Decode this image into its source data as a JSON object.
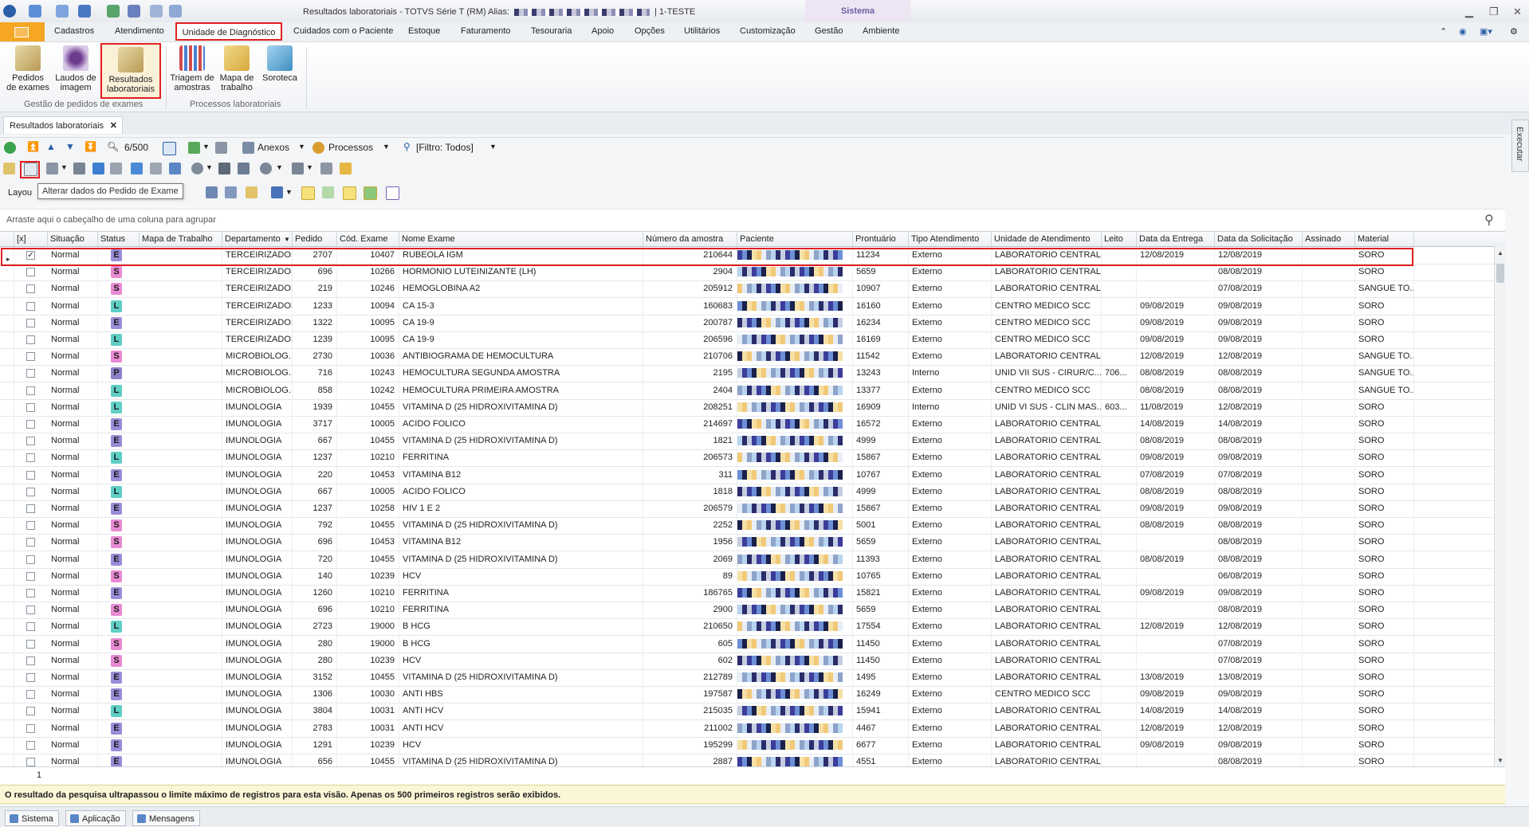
{
  "window": {
    "title": "Resultados laboratoriais - TOTVS Série T  (RM) Alias:",
    "title_suffix": "| 1-TESTE",
    "context_tab": "Sistema"
  },
  "ribbon_tabs": [
    "Cadastros",
    "Atendimento",
    "Unidade de Diagnóstico",
    "Cuidados com o Paciente",
    "Estoque",
    "Faturamento",
    "Tesouraria",
    "Apoio",
    "Opções",
    "Utilitários",
    "Customização",
    "Gestão",
    "Ambiente"
  ],
  "ribbon": {
    "groups": [
      {
        "name": "Gestão de pedidos de exames",
        "buttons": [
          {
            "line1": "Pedidos",
            "line2": "de exames",
            "icon": "pedidos-icon"
          },
          {
            "line1": "Laudos de",
            "line2": "imagem",
            "icon": "laudos-icon"
          },
          {
            "line1": "Resultados",
            "line2": "laboratoriais",
            "icon": "resultados-icon"
          }
        ]
      },
      {
        "name": "Processos laboratoriais",
        "buttons": [
          {
            "line1": "Triagem de",
            "line2": "amostras",
            "icon": "triagem-icon"
          },
          {
            "line1": "Mapa de",
            "line2": "trabalho",
            "icon": "mapa-icon"
          },
          {
            "line1": "Soroteca",
            "line2": "",
            "icon": "soroteca-icon"
          }
        ]
      }
    ]
  },
  "doc_tab": {
    "label": "Resultados laboratoriais",
    "close": "✕"
  },
  "toolbar": {
    "record_counter": "6/500",
    "anexos": "Anexos",
    "processos": "Processos",
    "filtro": "[Filtro: Todos]",
    "layout": "Layou",
    "side_panel": "Executar"
  },
  "tooltip": "Alterar dados do Pedido de Exame",
  "group_hint": "Arraste aqui o cabeçalho de uma coluna para agrupar",
  "columns": [
    "[x]",
    "Situação",
    "Status",
    "Mapa de Trabalho",
    "Departamento",
    "Pedido",
    "Cód. Exame",
    "Nome Exame",
    "Número da amostra",
    "Paciente",
    "Prontuário",
    "Tipo Atendimento",
    "Unidade de Atendimento",
    "Leito",
    "Data da Entrega",
    "Data da Solicitação",
    "Assinado",
    "Material"
  ],
  "status_colors": {
    "E": "#9b8cd9",
    "S": "#e88ad3",
    "L": "#5fcfc6",
    "P": "#8d82c9"
  },
  "rows": [
    {
      "chk": "✓",
      "sit": "Normal",
      "st": "E",
      "dep": "TERCEIRIZADOS",
      "ped": "2707",
      "cod": "10407",
      "nome": "RUBEOLA IGM",
      "amostra": "210644",
      "pront": "11234",
      "tipo": "Externo",
      "unid": "LABORATORIO CENTRAL",
      "leito": "",
      "entrega": "12/08/2019",
      "solic": "12/08/2019",
      "mat": "SORO"
    },
    {
      "chk": "",
      "sit": "Normal",
      "st": "S",
      "dep": "TERCEIRIZADOS",
      "ped": "696",
      "cod": "10266",
      "nome": "HORMONIO LUTEINIZANTE (LH)",
      "amostra": "2904",
      "pront": "5659",
      "tipo": "Externo",
      "unid": "LABORATORIO CENTRAL",
      "leito": "",
      "entrega": "",
      "solic": "08/08/2019",
      "mat": "SORO"
    },
    {
      "chk": "",
      "sit": "Normal",
      "st": "S",
      "dep": "TERCEIRIZADOS",
      "ped": "219",
      "cod": "10246",
      "nome": "HEMOGLOBINA A2",
      "amostra": "205912",
      "pront": "10907",
      "tipo": "Externo",
      "unid": "LABORATORIO CENTRAL",
      "leito": "",
      "entrega": "",
      "solic": "07/08/2019",
      "mat": "SANGUE TO..."
    },
    {
      "chk": "",
      "sit": "Normal",
      "st": "L",
      "dep": "TERCEIRIZADOS",
      "ped": "1233",
      "cod": "10094",
      "nome": "CA 15-3",
      "amostra": "160683",
      "pront": "16160",
      "tipo": "Externo",
      "unid": "CENTRO MEDICO SCC",
      "leito": "",
      "entrega": "09/08/2019",
      "solic": "09/08/2019",
      "mat": "SORO"
    },
    {
      "chk": "",
      "sit": "Normal",
      "st": "E",
      "dep": "TERCEIRIZADOS",
      "ped": "1322",
      "cod": "10095",
      "nome": "CA 19-9",
      "amostra": "200787",
      "pront": "16234",
      "tipo": "Externo",
      "unid": "CENTRO MEDICO SCC",
      "leito": "",
      "entrega": "09/08/2019",
      "solic": "09/08/2019",
      "mat": "SORO"
    },
    {
      "chk": "",
      "sit": "Normal",
      "st": "L",
      "dep": "TERCEIRIZADOS",
      "ped": "1239",
      "cod": "10095",
      "nome": "CA 19-9",
      "amostra": "206596",
      "pront": "16169",
      "tipo": "Externo",
      "unid": "CENTRO MEDICO SCC",
      "leito": "",
      "entrega": "09/08/2019",
      "solic": "09/08/2019",
      "mat": "SORO"
    },
    {
      "chk": "",
      "sit": "Normal",
      "st": "S",
      "dep": "MICROBIOLOG...",
      "ped": "2730",
      "cod": "10036",
      "nome": "ANTIBIOGRAMA DE HEMOCULTURA",
      "amostra": "210706",
      "pront": "11542",
      "tipo": "Externo",
      "unid": "LABORATORIO CENTRAL",
      "leito": "",
      "entrega": "12/08/2019",
      "solic": "12/08/2019",
      "mat": "SANGUE TO..."
    },
    {
      "chk": "",
      "sit": "Normal",
      "st": "P",
      "dep": "MICROBIOLOG...",
      "ped": "716",
      "cod": "10243",
      "nome": "HEMOCULTURA SEGUNDA AMOSTRA",
      "amostra": "2195",
      "pront": "13243",
      "tipo": "Interno",
      "unid": "UNID VII SUS - CIRUR/C...",
      "leito": "706...",
      "entrega": "08/08/2019",
      "solic": "08/08/2019",
      "mat": "SANGUE TO..."
    },
    {
      "chk": "",
      "sit": "Normal",
      "st": "L",
      "dep": "MICROBIOLOG...",
      "ped": "858",
      "cod": "10242",
      "nome": "HEMOCULTURA PRIMEIRA AMOSTRA",
      "amostra": "2404",
      "pront": "13377",
      "tipo": "Externo",
      "unid": "CENTRO MEDICO SCC",
      "leito": "",
      "entrega": "08/08/2019",
      "solic": "08/08/2019",
      "mat": "SANGUE TO..."
    },
    {
      "chk": "",
      "sit": "Normal",
      "st": "L",
      "dep": "IMUNOLOGIA",
      "ped": "1939",
      "cod": "10455",
      "nome": "VITAMINA D (25 HIDROXIVITAMINA D)",
      "amostra": "208251",
      "pront": "16909",
      "tipo": "Interno",
      "unid": "UNID VI SUS - CLIN MAS...",
      "leito": "603...",
      "entrega": "11/08/2019",
      "solic": "12/08/2019",
      "mat": "SORO"
    },
    {
      "chk": "",
      "sit": "Normal",
      "st": "E",
      "dep": "IMUNOLOGIA",
      "ped": "3717",
      "cod": "10005",
      "nome": "ACIDO FOLICO",
      "amostra": "214697",
      "pront": "16572",
      "tipo": "Externo",
      "unid": "LABORATORIO CENTRAL",
      "leito": "",
      "entrega": "14/08/2019",
      "solic": "14/08/2019",
      "mat": "SORO"
    },
    {
      "chk": "",
      "sit": "Normal",
      "st": "E",
      "dep": "IMUNOLOGIA",
      "ped": "667",
      "cod": "10455",
      "nome": "VITAMINA D (25 HIDROXIVITAMINA D)",
      "amostra": "1821",
      "pront": "4999",
      "tipo": "Externo",
      "unid": "LABORATORIO CENTRAL",
      "leito": "",
      "entrega": "08/08/2019",
      "solic": "08/08/2019",
      "mat": "SORO"
    },
    {
      "chk": "",
      "sit": "Normal",
      "st": "L",
      "dep": "IMUNOLOGIA",
      "ped": "1237",
      "cod": "10210",
      "nome": "FERRITINA",
      "amostra": "206573",
      "pront": "15867",
      "tipo": "Externo",
      "unid": "LABORATORIO CENTRAL",
      "leito": "",
      "entrega": "09/08/2019",
      "solic": "09/08/2019",
      "mat": "SORO"
    },
    {
      "chk": "",
      "sit": "Normal",
      "st": "E",
      "dep": "IMUNOLOGIA",
      "ped": "220",
      "cod": "10453",
      "nome": "VITAMINA B12",
      "amostra": "311",
      "pront": "10767",
      "tipo": "Externo",
      "unid": "LABORATORIO CENTRAL",
      "leito": "",
      "entrega": "07/08/2019",
      "solic": "07/08/2019",
      "mat": "SORO"
    },
    {
      "chk": "",
      "sit": "Normal",
      "st": "L",
      "dep": "IMUNOLOGIA",
      "ped": "667",
      "cod": "10005",
      "nome": "ACIDO FOLICO",
      "amostra": "1818",
      "pront": "4999",
      "tipo": "Externo",
      "unid": "LABORATORIO CENTRAL",
      "leito": "",
      "entrega": "08/08/2019",
      "solic": "08/08/2019",
      "mat": "SORO"
    },
    {
      "chk": "",
      "sit": "Normal",
      "st": "E",
      "dep": "IMUNOLOGIA",
      "ped": "1237",
      "cod": "10258",
      "nome": "HIV 1 E 2",
      "amostra": "206579",
      "pront": "15867",
      "tipo": "Externo",
      "unid": "LABORATORIO CENTRAL",
      "leito": "",
      "entrega": "09/08/2019",
      "solic": "09/08/2019",
      "mat": "SORO"
    },
    {
      "chk": "",
      "sit": "Normal",
      "st": "S",
      "dep": "IMUNOLOGIA",
      "ped": "792",
      "cod": "10455",
      "nome": "VITAMINA D (25 HIDROXIVITAMINA D)",
      "amostra": "2252",
      "pront": "5001",
      "tipo": "Externo",
      "unid": "LABORATORIO CENTRAL",
      "leito": "",
      "entrega": "08/08/2019",
      "solic": "08/08/2019",
      "mat": "SORO"
    },
    {
      "chk": "",
      "sit": "Normal",
      "st": "S",
      "dep": "IMUNOLOGIA",
      "ped": "696",
      "cod": "10453",
      "nome": "VITAMINA B12",
      "amostra": "1956",
      "pront": "5659",
      "tipo": "Externo",
      "unid": "LABORATORIO CENTRAL",
      "leito": "",
      "entrega": "",
      "solic": "08/08/2019",
      "mat": "SORO"
    },
    {
      "chk": "",
      "sit": "Normal",
      "st": "E",
      "dep": "IMUNOLOGIA",
      "ped": "720",
      "cod": "10455",
      "nome": "VITAMINA D (25 HIDROXIVITAMINA D)",
      "amostra": "2069",
      "pront": "11393",
      "tipo": "Externo",
      "unid": "LABORATORIO CENTRAL",
      "leito": "",
      "entrega": "08/08/2019",
      "solic": "08/08/2019",
      "mat": "SORO"
    },
    {
      "chk": "",
      "sit": "Normal",
      "st": "S",
      "dep": "IMUNOLOGIA",
      "ped": "140",
      "cod": "10239",
      "nome": "HCV",
      "amostra": "89",
      "pront": "10765",
      "tipo": "Externo",
      "unid": "LABORATORIO CENTRAL",
      "leito": "",
      "entrega": "",
      "solic": "06/08/2019",
      "mat": "SORO"
    },
    {
      "chk": "",
      "sit": "Normal",
      "st": "E",
      "dep": "IMUNOLOGIA",
      "ped": "1260",
      "cod": "10210",
      "nome": "FERRITINA",
      "amostra": "186765",
      "pront": "15821",
      "tipo": "Externo",
      "unid": "LABORATORIO CENTRAL",
      "leito": "",
      "entrega": "09/08/2019",
      "solic": "09/08/2019",
      "mat": "SORO"
    },
    {
      "chk": "",
      "sit": "Normal",
      "st": "S",
      "dep": "IMUNOLOGIA",
      "ped": "696",
      "cod": "10210",
      "nome": "FERRITINA",
      "amostra": "2900",
      "pront": "5659",
      "tipo": "Externo",
      "unid": "LABORATORIO CENTRAL",
      "leito": "",
      "entrega": "",
      "solic": "08/08/2019",
      "mat": "SORO"
    },
    {
      "chk": "",
      "sit": "Normal",
      "st": "L",
      "dep": "IMUNOLOGIA",
      "ped": "2723",
      "cod": "19000",
      "nome": "B HCG",
      "amostra": "210650",
      "pront": "17554",
      "tipo": "Externo",
      "unid": "LABORATORIO CENTRAL",
      "leito": "",
      "entrega": "12/08/2019",
      "solic": "12/08/2019",
      "mat": "SORO"
    },
    {
      "chk": "",
      "sit": "Normal",
      "st": "S",
      "dep": "IMUNOLOGIA",
      "ped": "280",
      "cod": "19000",
      "nome": "B HCG",
      "amostra": "605",
      "pront": "11450",
      "tipo": "Externo",
      "unid": "LABORATORIO CENTRAL",
      "leito": "",
      "entrega": "",
      "solic": "07/08/2019",
      "mat": "SORO"
    },
    {
      "chk": "",
      "sit": "Normal",
      "st": "S",
      "dep": "IMUNOLOGIA",
      "ped": "280",
      "cod": "10239",
      "nome": "HCV",
      "amostra": "602",
      "pront": "11450",
      "tipo": "Externo",
      "unid": "LABORATORIO CENTRAL",
      "leito": "",
      "entrega": "",
      "solic": "07/08/2019",
      "mat": "SORO"
    },
    {
      "chk": "",
      "sit": "Normal",
      "st": "E",
      "dep": "IMUNOLOGIA",
      "ped": "3152",
      "cod": "10455",
      "nome": "VITAMINA D (25 HIDROXIVITAMINA D)",
      "amostra": "212789",
      "pront": "1495",
      "tipo": "Externo",
      "unid": "LABORATORIO CENTRAL",
      "leito": "",
      "entrega": "13/08/2019",
      "solic": "13/08/2019",
      "mat": "SORO"
    },
    {
      "chk": "",
      "sit": "Normal",
      "st": "E",
      "dep": "IMUNOLOGIA",
      "ped": "1306",
      "cod": "10030",
      "nome": "ANTI HBS",
      "amostra": "197587",
      "pront": "16249",
      "tipo": "Externo",
      "unid": "CENTRO MEDICO SCC",
      "leito": "",
      "entrega": "09/08/2019",
      "solic": "09/08/2019",
      "mat": "SORO"
    },
    {
      "chk": "",
      "sit": "Normal",
      "st": "L",
      "dep": "IMUNOLOGIA",
      "ped": "3804",
      "cod": "10031",
      "nome": "ANTI HCV",
      "amostra": "215035",
      "pront": "15941",
      "tipo": "Externo",
      "unid": "LABORATORIO CENTRAL",
      "leito": "",
      "entrega": "14/08/2019",
      "solic": "14/08/2019",
      "mat": "SORO"
    },
    {
      "chk": "",
      "sit": "Normal",
      "st": "E",
      "dep": "IMUNOLOGIA",
      "ped": "2783",
      "cod": "10031",
      "nome": "ANTI HCV",
      "amostra": "211002",
      "pront": "4467",
      "tipo": "Externo",
      "unid": "LABORATORIO CENTRAL",
      "leito": "",
      "entrega": "12/08/2019",
      "solic": "12/08/2019",
      "mat": "SORO"
    },
    {
      "chk": "",
      "sit": "Normal",
      "st": "E",
      "dep": "IMUNOLOGIA",
      "ped": "1291",
      "cod": "10239",
      "nome": "HCV",
      "amostra": "195299",
      "pront": "6677",
      "tipo": "Externo",
      "unid": "LABORATORIO CENTRAL",
      "leito": "",
      "entrega": "09/08/2019",
      "solic": "09/08/2019",
      "mat": "SORO"
    },
    {
      "chk": "",
      "sit": "Normal",
      "st": "E",
      "dep": "IMUNOLOGIA",
      "ped": "656",
      "cod": "10455",
      "nome": "VITAMINA D (25 HIDROXIVITAMINA D)",
      "amostra": "2887",
      "pront": "4551",
      "tipo": "Externo",
      "unid": "LABORATORIO CENTRAL",
      "leito": "",
      "entrega": "",
      "solic": "08/08/2019",
      "mat": "SORO"
    }
  ],
  "footer": {
    "count": "1"
  },
  "status_message": "O resultado da pesquisa ultrapassou o limite máximo de registros para esta visão. Apenas os 500 primeiros registros serão exibidos.",
  "bottom_tabs": [
    "Sistema",
    "Aplicação",
    "Mensagens"
  ]
}
